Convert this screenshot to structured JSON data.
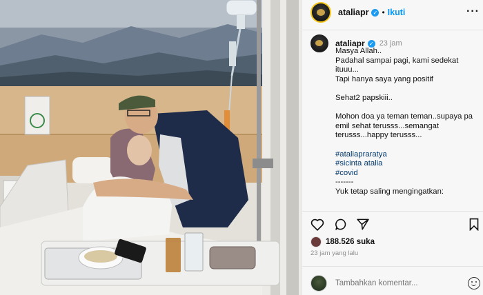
{
  "post": {
    "username": "ataliapr",
    "follow_label": "Ikuti",
    "more_label": "···",
    "caption_time": "23 jam",
    "caption_lines": [
      "Masya Allah..",
      "Padahal sampai pagi, kami sedekat",
      "ituuu...",
      "Tapi hanya saya yang positif",
      "",
      "Sehat2 papskiii..",
      "",
      "Mohon doa ya teman teman..supaya pa",
      "emil sehat terusss...semangat",
      "terusss...happy terusss...",
      "",
      "#ataliapraratya",
      "#sicinta atalia",
      "#covid",
      "-------",
      "Yuk tetap saling mengingatkan:"
    ],
    "likes": "188.526 suka",
    "posted_ago": "23 jam yang lalu",
    "comment_placeholder": "Tambahkan komentar..."
  },
  "icons": {
    "verified": "verified-badge-icon",
    "like": "heart-icon",
    "comment": "comment-icon",
    "share": "send-icon",
    "save": "bookmark-icon",
    "emoji": "smiley-icon"
  },
  "colors": {
    "link": "#0095f6",
    "hashtag": "#00376b",
    "muted": "#8e8e8e",
    "verified": "#1d9bf0"
  }
}
